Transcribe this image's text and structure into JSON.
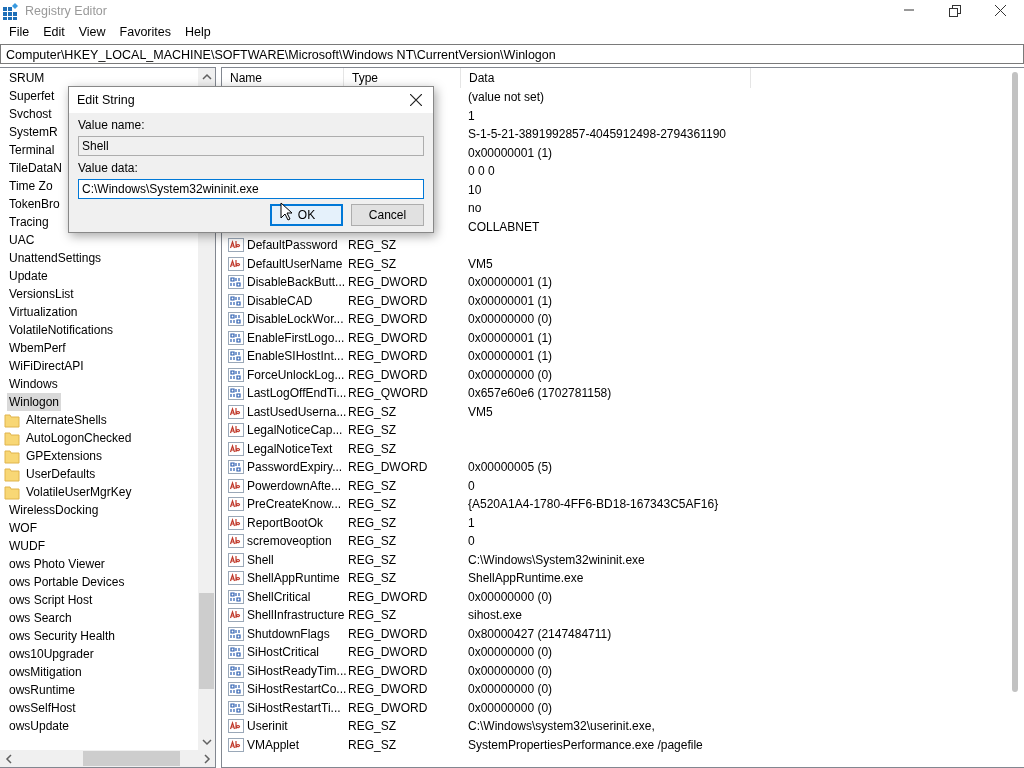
{
  "window": {
    "title": "Registry Editor"
  },
  "menu": [
    "File",
    "Edit",
    "View",
    "Favorites",
    "Help"
  ],
  "address": "Computer\\HKEY_LOCAL_MACHINE\\SOFTWARE\\Microsoft\\Windows NT\\CurrentVersion\\Winlogon",
  "tree": [
    {
      "label": "SRUM",
      "selected": false
    },
    {
      "label": "Superfet",
      "selected": false
    },
    {
      "label": "Svchost",
      "selected": false
    },
    {
      "label": "SystemR",
      "selected": false
    },
    {
      "label": "Terminal",
      "selected": false
    },
    {
      "label": "TileDataN",
      "selected": false
    },
    {
      "label": "Time Zo",
      "selected": false
    },
    {
      "label": "TokenBro",
      "selected": false
    },
    {
      "label": "Tracing",
      "selected": false
    },
    {
      "label": "UAC",
      "selected": false
    },
    {
      "label": "UnattendSettings",
      "selected": false
    },
    {
      "label": "Update",
      "selected": false
    },
    {
      "label": "VersionsList",
      "selected": false
    },
    {
      "label": "Virtualization",
      "selected": false
    },
    {
      "label": "VolatileNotifications",
      "selected": false
    },
    {
      "label": "WbemPerf",
      "selected": false
    },
    {
      "label": "WiFiDirectAPI",
      "selected": false
    },
    {
      "label": "Windows",
      "selected": false
    },
    {
      "label": "Winlogon",
      "selected": true,
      "children": [
        {
          "label": "AlternateShells",
          "selected": false
        },
        {
          "label": "AutoLogonChecked",
          "selected": false
        },
        {
          "label": "GPExtensions",
          "selected": false
        },
        {
          "label": "UserDefaults",
          "selected": false
        },
        {
          "label": "VolatileUserMgrKey",
          "selected": false
        }
      ]
    },
    {
      "label": "WirelessDocking",
      "selected": false
    },
    {
      "label": "WOF",
      "selected": false
    },
    {
      "label": "WUDF",
      "selected": false
    },
    {
      "label": "ows Photo Viewer",
      "selected": false
    },
    {
      "label": "ows Portable Devices",
      "selected": false
    },
    {
      "label": "ows Script Host",
      "selected": false
    },
    {
      "label": "ows Search",
      "selected": false
    },
    {
      "label": "ows Security Health",
      "selected": false
    },
    {
      "label": "ows10Upgrader",
      "selected": false
    },
    {
      "label": "owsMitigation",
      "selected": false
    },
    {
      "label": "owsRuntime",
      "selected": false
    },
    {
      "label": "owsSelfHost",
      "selected": false
    },
    {
      "label": "owsUpdate",
      "selected": false
    }
  ],
  "columns": [
    "Name",
    "Type",
    "Data"
  ],
  "rows": [
    {
      "data": "(value not set)"
    },
    {
      "data": "1"
    },
    {
      "data": "S-1-5-21-3891992857-4045912498-2794361190"
    },
    {
      "data": "0x00000001 (1)"
    },
    {
      "data": "0 0 0"
    },
    {
      "data": "10"
    },
    {
      "data": "no"
    },
    {
      "data": "COLLABNET"
    },
    {
      "kind": "text",
      "name": "DefaultPassword",
      "type": "REG_SZ"
    },
    {
      "kind": "text",
      "name": "DefaultUserName",
      "type": "REG_SZ",
      "data": "VM5"
    },
    {
      "kind": "number",
      "name": "DisableBackButt...",
      "type": "REG_DWORD",
      "data": "0x00000001 (1)"
    },
    {
      "kind": "number",
      "name": "DisableCAD",
      "type": "REG_DWORD",
      "data": "0x00000001 (1)"
    },
    {
      "kind": "number",
      "name": "DisableLockWor...",
      "type": "REG_DWORD",
      "data": "0x00000000 (0)"
    },
    {
      "kind": "number",
      "name": "EnableFirstLogo...",
      "type": "REG_DWORD",
      "data": "0x00000001 (1)"
    },
    {
      "kind": "number",
      "name": "EnableSIHostInt...",
      "type": "REG_DWORD",
      "data": "0x00000001 (1)"
    },
    {
      "kind": "number",
      "name": "ForceUnlockLog...",
      "type": "REG_DWORD",
      "data": "0x00000000 (0)"
    },
    {
      "kind": "number",
      "name": "LastLogOffEndTi...",
      "type": "REG_QWORD",
      "data": "0x657e60e6 (1702781158)"
    },
    {
      "kind": "text",
      "name": "LastUsedUserna...",
      "type": "REG_SZ",
      "data": "VM5"
    },
    {
      "kind": "text",
      "name": "LegalNoticeCap...",
      "type": "REG_SZ"
    },
    {
      "kind": "text",
      "name": "LegalNoticeText",
      "type": "REG_SZ"
    },
    {
      "kind": "number",
      "name": "PasswordExpiry...",
      "type": "REG_DWORD",
      "data": "0x00000005 (5)"
    },
    {
      "kind": "text",
      "name": "PowerdownAfte...",
      "type": "REG_SZ",
      "data": "0"
    },
    {
      "kind": "text",
      "name": "PreCreateKnow...",
      "type": "REG_SZ",
      "data": "{A520A1A4-1780-4FF6-BD18-167343C5AF16}"
    },
    {
      "kind": "text",
      "name": "ReportBootOk",
      "type": "REG_SZ",
      "data": "1"
    },
    {
      "kind": "text",
      "name": "scremoveoption",
      "type": "REG_SZ",
      "data": "0"
    },
    {
      "kind": "text",
      "name": "Shell",
      "type": "REG_SZ",
      "data": "C:\\Windows\\System32wininit.exe"
    },
    {
      "kind": "text",
      "name": "ShellAppRuntime",
      "type": "REG_SZ",
      "data": "ShellAppRuntime.exe"
    },
    {
      "kind": "number",
      "name": "ShellCritical",
      "type": "REG_DWORD",
      "data": "0x00000000 (0)"
    },
    {
      "kind": "text",
      "name": "ShellInfrastructure",
      "type": "REG_SZ",
      "data": "sihost.exe"
    },
    {
      "kind": "number",
      "name": "ShutdownFlags",
      "type": "REG_DWORD",
      "data": "0x80000427 (2147484711)"
    },
    {
      "kind": "number",
      "name": "SiHostCritical",
      "type": "REG_DWORD",
      "data": "0x00000000 (0)"
    },
    {
      "kind": "number",
      "name": "SiHostReadyTim...",
      "type": "REG_DWORD",
      "data": "0x00000000 (0)"
    },
    {
      "kind": "number",
      "name": "SiHostRestartCo...",
      "type": "REG_DWORD",
      "data": "0x00000000 (0)"
    },
    {
      "kind": "number",
      "name": "SiHostRestartTi...",
      "type": "REG_DWORD",
      "data": "0x00000000 (0)"
    },
    {
      "kind": "text",
      "name": "Userinit",
      "type": "REG_SZ",
      "data": "C:\\Windows\\system32\\userinit.exe,"
    },
    {
      "kind": "text",
      "name": "VMApplet",
      "type": "REG_SZ",
      "data": "SystemPropertiesPerformance.exe /pagefile"
    }
  ],
  "dialog": {
    "title": "Edit String",
    "name_label": "Value name:",
    "name_value": "Shell",
    "data_label": "Value data:",
    "data_value": "C:\\Windows\\System32wininit.exe",
    "buttons": [
      {
        "label": "OK",
        "default": true
      },
      {
        "label": "Cancel",
        "default": false
      }
    ]
  }
}
